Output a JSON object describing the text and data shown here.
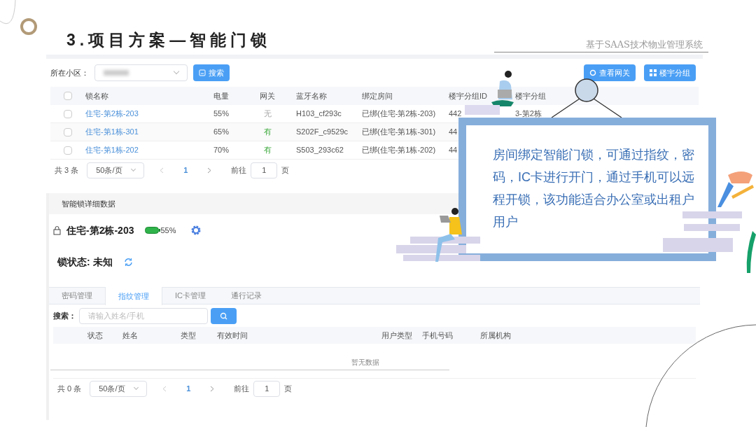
{
  "slide": {
    "title": "3.项目方案—智能门锁",
    "subtitle": "基于SAAS技术物业管理系统"
  },
  "filter": {
    "label": "所在小区：",
    "search_button": "搜索"
  },
  "actions": [
    {
      "kind": "gateway",
      "label": "查看网关"
    },
    {
      "kind": "group",
      "label": "楼宇分组"
    }
  ],
  "lock_table": {
    "select_all": false,
    "columns": [
      "锁名称",
      "电量",
      "网关",
      "蓝牙名称",
      "绑定房间",
      "楼宇分组ID",
      "楼宇分组"
    ],
    "rows": [
      {
        "checked": false,
        "name": "住宅-第2栋-203",
        "battery": "55%",
        "gateway": "无",
        "online": false,
        "bluetooth": "H103_cf293c",
        "room": "已绑(住宅-第2栋-203)",
        "group_id": "442",
        "group": "3-第2栋"
      },
      {
        "checked": false,
        "name": "住宅-第1栋-301",
        "battery": "65%",
        "gateway": "有",
        "online": true,
        "bluetooth": "S202F_c9529c",
        "room": "已绑(住宅-第1栋-301)",
        "group_id": "44"
      },
      {
        "checked": false,
        "name": "住宅-第1栋-202",
        "battery": "70%",
        "gateway": "有",
        "online": true,
        "bluetooth": "S503_293c62",
        "room": "已绑(住宅-第1栋-202)",
        "group_id": "44"
      }
    ]
  },
  "lock_pagination": {
    "total": "共 3 条",
    "page_size": "50条/页",
    "page": "1",
    "goto": "前往",
    "goto_value": "1",
    "unit": "页"
  },
  "detail": {
    "header": "智能锁详细数据",
    "lock_name": "住宅-第2栋-203",
    "battery": "55%",
    "status": "锁状态: 未知",
    "tabs": [
      {
        "label": "密码管理",
        "selected": false
      },
      {
        "label": "指纹管理",
        "selected": true
      },
      {
        "label": "IC卡管理",
        "selected": false
      },
      {
        "label": "通行记录",
        "selected": false
      }
    ],
    "search_label": "搜索：",
    "search": {
      "placeholder": "请输入姓名/手机"
    },
    "columns": [
      "状态",
      "姓名",
      "类型",
      "有效时间",
      "用户类型",
      "手机号码",
      "所属机构"
    ],
    "empty": "暂无数据",
    "pagination": {
      "total": "共 0 条",
      "page_size": "50条/页",
      "page": "1",
      "goto": "前往",
      "goto_value": "1",
      "unit": "页"
    }
  },
  "callout": {
    "text": "房间绑定智能门锁，可通过指纹，密码，IC卡进行开门，通过手机可以远程开锁，该功能适合办公室或出租户用户"
  }
}
